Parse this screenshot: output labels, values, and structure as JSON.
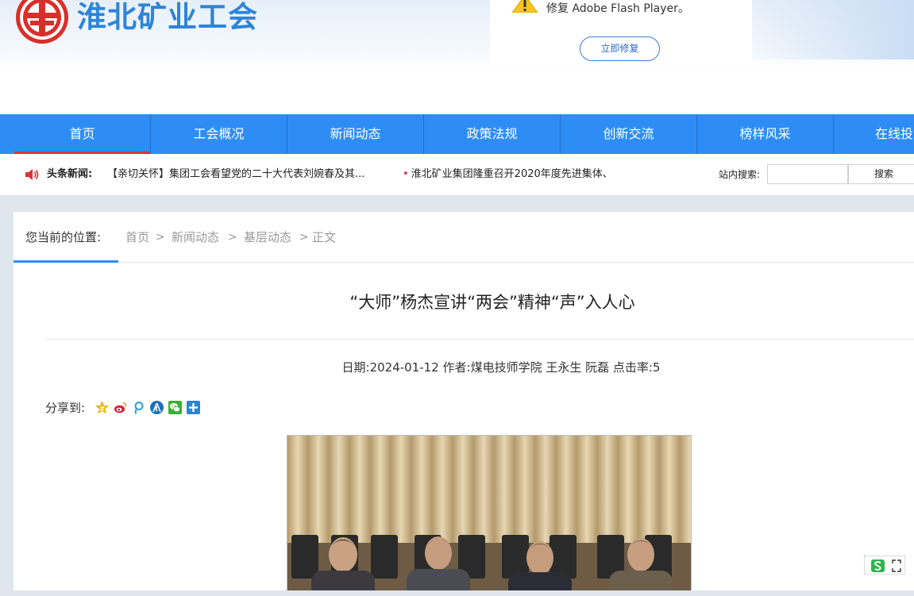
{
  "header": {
    "site_name": "淮北矿业工会",
    "logo_icon": "union-emblem-icon",
    "brand_color": "#2d84d8"
  },
  "flash_notice": {
    "message": "修复 Adobe Flash Player。",
    "repair_button": "立即修复",
    "icon": "warning-icon"
  },
  "nav": {
    "items": [
      "首页",
      "工会概况",
      "新闻动态",
      "政策法规",
      "创新交流",
      "榜样风采",
      "在线投"
    ],
    "active_index": 0,
    "bar_color": "#2e8df5",
    "active_underline_color": "#d8353b"
  },
  "ticker": {
    "label": "头条新闻:",
    "item1": "【亲切关怀】集团工会看望党的二十大代表刘婉春及其...",
    "item2": "淮北矿业集团隆重召开2020年度先进集体、",
    "bullet": "•",
    "icon": "speaker-icon"
  },
  "search": {
    "label": "站内搜索:",
    "value": "",
    "button": "搜索"
  },
  "breadcrumb": {
    "label": "您当前的位置:",
    "items": [
      "首页",
      "新闻动态",
      "基层动态",
      "正文"
    ],
    "separator": ">"
  },
  "article": {
    "title": "“大师”杨杰宣讲“两会”精神“声”入人心",
    "meta": "日期:2024-01-12 作者:煤电技师学院 王永生 阮磊 点击率:5"
  },
  "share": {
    "label": "分享到:",
    "icons": [
      "qzone-icon",
      "weibo-icon",
      "tencent-weibo-icon",
      "renren-icon",
      "wechat-icon",
      "more-share-icon"
    ]
  },
  "float_tool": {
    "icons": [
      "sogou-s-icon",
      "expand-icon"
    ]
  }
}
